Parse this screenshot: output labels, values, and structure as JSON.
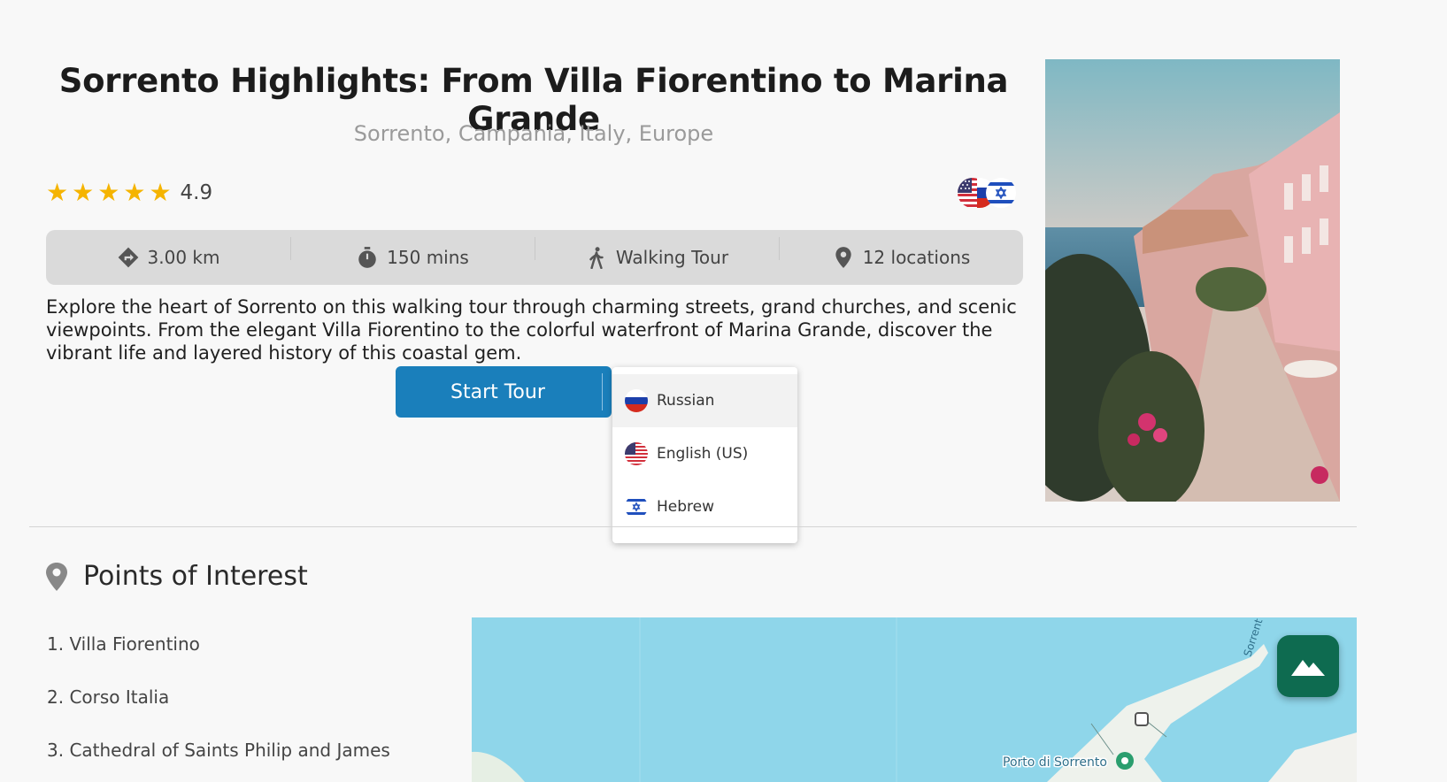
{
  "tour": {
    "title": "Sorrento Highlights: From Villa Fiorentino to Marina Grande",
    "location": "Sorrento, Campania, Italy, Europe",
    "rating": "4.9",
    "stars_filled": 5,
    "description": "Explore the heart of Sorrento on this walking tour through charming streets, grand churches, and scenic viewpoints. From the elegant Villa Fiorentino to the colorful waterfront of Marina Grande, discover the vibrant life and layered history of this coastal gem."
  },
  "stats": {
    "distance": "3.00 km",
    "duration": "150 mins",
    "type": "Walking Tour",
    "locations": "12 locations"
  },
  "actions": {
    "start_label": "Start Tour"
  },
  "language_menu": {
    "items": [
      {
        "label": "Russian",
        "flag": "russia-flag-icon"
      },
      {
        "label": "English (US)",
        "flag": "us-flag-icon"
      },
      {
        "label": "Hebrew",
        "flag": "israel-flag-icon"
      }
    ]
  },
  "poi": {
    "heading": "Points of Interest",
    "items": [
      "1. Villa Fiorentino",
      "2. Corso Italia",
      "3. Cathedral of Saints Philip and James"
    ]
  },
  "map": {
    "labels": [
      "Porto di Sorrento",
      "Sorrent"
    ]
  },
  "colors": {
    "accent": "#1a7fbb",
    "star": "#f5b400",
    "fab": "#0e6b50",
    "sea": "#8fd6ea"
  }
}
